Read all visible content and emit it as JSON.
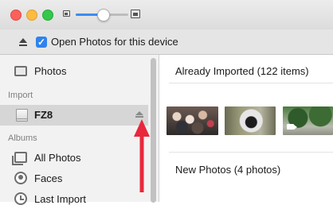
{
  "toolbar": {
    "open_photos_label": "Open Photos for this device",
    "checkbox_checked": true
  },
  "zoom": {
    "level": 0.52
  },
  "sidebar": {
    "photos_label": "Photos",
    "import_header": "Import",
    "device_label": "FZ8",
    "albums_header": "Albums",
    "albums": [
      {
        "label": "All Photos",
        "icon": "stack-icon"
      },
      {
        "label": "Faces",
        "icon": "faces-icon"
      },
      {
        "label": "Last Import",
        "icon": "clock-icon"
      }
    ]
  },
  "main": {
    "already_imported": "Already Imported (122 items)",
    "new_photos": "New Photos (4 photos)"
  },
  "colors": {
    "accent": "#2f83ee",
    "annotation_arrow": "#e8283c"
  }
}
